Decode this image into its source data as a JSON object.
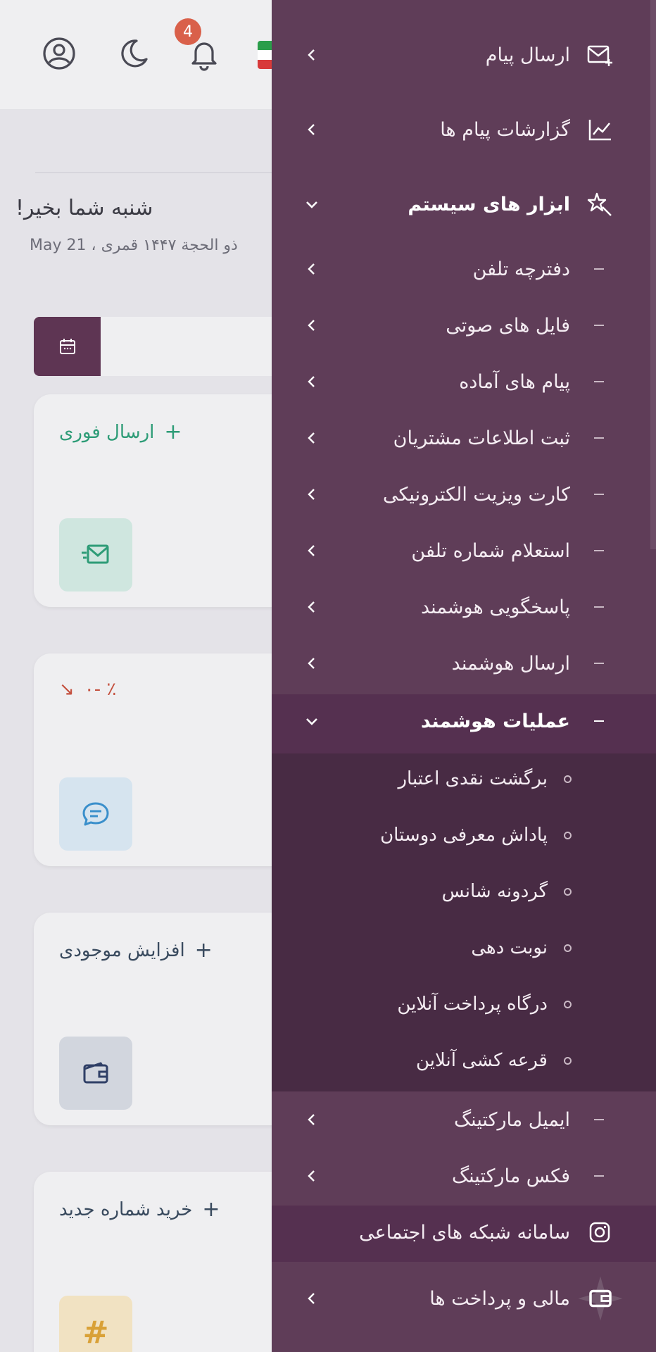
{
  "header": {
    "notification_count": "4",
    "icons": [
      "user-circle-icon",
      "moon-icon",
      "bell-icon",
      "iran-flag-icon"
    ]
  },
  "dashboard": {
    "greeting": "شنبه شما بخیر!",
    "date_line": "ذو الحجة ۱۴۴۷ قمری ، 21 May",
    "cards": [
      {
        "title": "ارسال فوری",
        "title_color": "#2e9c77",
        "icon": "send-mail-icon",
        "icon_bg": "#cfe6df",
        "icon_color": "#2e9c77"
      },
      {
        "title": "٪ -٠",
        "title_color": "#c4503e",
        "icon": "chat-bubble-icon",
        "icon_bg": "#d6e4ef",
        "icon_color": "#3a8fcb"
      },
      {
        "title": "افزایش موجودی",
        "title_color": "#394a5e",
        "icon": "wallet-icon",
        "icon_bg": "#d2d6de",
        "icon_color": "#2f3f66"
      },
      {
        "title": "خرید شماره جدید",
        "title_color": "#394a5e",
        "icon": "hashtag-icon",
        "icon_bg": "#f1e2c2",
        "icon_color": "#d9a137"
      }
    ]
  },
  "sidebar": {
    "items": [
      {
        "label": "ارسال پیام",
        "icon": "mail-plus-icon"
      },
      {
        "label": "گزارشات پیام ها",
        "icon": "chart-line-icon"
      },
      {
        "label": "ابزار های سیستم",
        "icon": "magic-star-icon",
        "expanded": true
      },
      {
        "label": "دفترچه تلفن"
      },
      {
        "label": "فایل های صوتی"
      },
      {
        "label": "پیام های آماده"
      },
      {
        "label": "ثبت اطلاعات مشتریان"
      },
      {
        "label": "کارت ویزیت الکترونیکی"
      },
      {
        "label": "استعلام شماره تلفن"
      },
      {
        "label": "پاسخگویی هوشمند"
      },
      {
        "label": "ارسال هوشمند"
      },
      {
        "label": "عملیات هوشمند",
        "expanded": true
      },
      {
        "label": "برگشت نقدی اعتبار"
      },
      {
        "label": "پاداش معرفی دوستان"
      },
      {
        "label": "گردونه شانس"
      },
      {
        "label": "نوبت دهی"
      },
      {
        "label": "درگاه پرداخت آنلاین"
      },
      {
        "label": "قرعه کشی آنلاین"
      },
      {
        "label": "ایمیل مارکتینگ"
      },
      {
        "label": "فکس مارکتینگ"
      },
      {
        "label": "سامانه شبکه های اجتماعی",
        "icon": "instagram-icon"
      },
      {
        "label": "مالی و پرداخت ها",
        "icon": "wallet-icon"
      }
    ]
  },
  "colors": {
    "sidebar_bg": "#5f3d58",
    "accent": "#5e3553"
  }
}
